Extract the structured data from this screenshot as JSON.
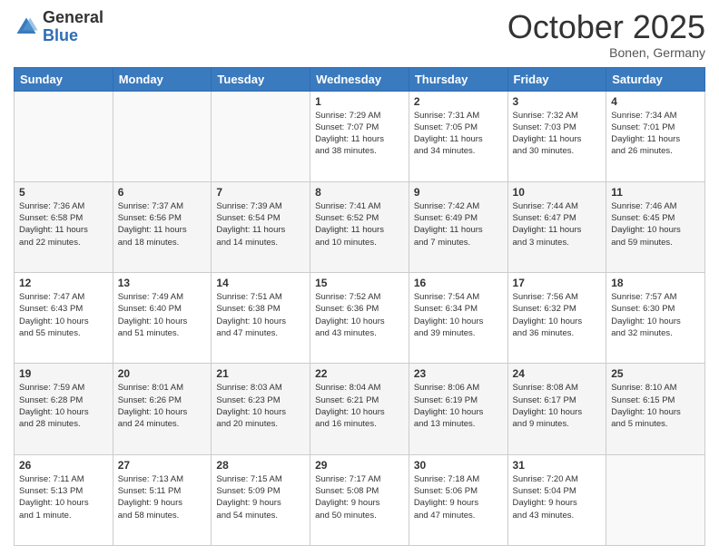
{
  "header": {
    "logo_general": "General",
    "logo_blue": "Blue",
    "month": "October 2025",
    "location": "Bonen, Germany"
  },
  "weekdays": [
    "Sunday",
    "Monday",
    "Tuesday",
    "Wednesday",
    "Thursday",
    "Friday",
    "Saturday"
  ],
  "weeks": [
    [
      {
        "day": "",
        "info": ""
      },
      {
        "day": "",
        "info": ""
      },
      {
        "day": "",
        "info": ""
      },
      {
        "day": "1",
        "info": "Sunrise: 7:29 AM\nSunset: 7:07 PM\nDaylight: 11 hours\nand 38 minutes."
      },
      {
        "day": "2",
        "info": "Sunrise: 7:31 AM\nSunset: 7:05 PM\nDaylight: 11 hours\nand 34 minutes."
      },
      {
        "day": "3",
        "info": "Sunrise: 7:32 AM\nSunset: 7:03 PM\nDaylight: 11 hours\nand 30 minutes."
      },
      {
        "day": "4",
        "info": "Sunrise: 7:34 AM\nSunset: 7:01 PM\nDaylight: 11 hours\nand 26 minutes."
      }
    ],
    [
      {
        "day": "5",
        "info": "Sunrise: 7:36 AM\nSunset: 6:58 PM\nDaylight: 11 hours\nand 22 minutes."
      },
      {
        "day": "6",
        "info": "Sunrise: 7:37 AM\nSunset: 6:56 PM\nDaylight: 11 hours\nand 18 minutes."
      },
      {
        "day": "7",
        "info": "Sunrise: 7:39 AM\nSunset: 6:54 PM\nDaylight: 11 hours\nand 14 minutes."
      },
      {
        "day": "8",
        "info": "Sunrise: 7:41 AM\nSunset: 6:52 PM\nDaylight: 11 hours\nand 10 minutes."
      },
      {
        "day": "9",
        "info": "Sunrise: 7:42 AM\nSunset: 6:49 PM\nDaylight: 11 hours\nand 7 minutes."
      },
      {
        "day": "10",
        "info": "Sunrise: 7:44 AM\nSunset: 6:47 PM\nDaylight: 11 hours\nand 3 minutes."
      },
      {
        "day": "11",
        "info": "Sunrise: 7:46 AM\nSunset: 6:45 PM\nDaylight: 10 hours\nand 59 minutes."
      }
    ],
    [
      {
        "day": "12",
        "info": "Sunrise: 7:47 AM\nSunset: 6:43 PM\nDaylight: 10 hours\nand 55 minutes."
      },
      {
        "day": "13",
        "info": "Sunrise: 7:49 AM\nSunset: 6:40 PM\nDaylight: 10 hours\nand 51 minutes."
      },
      {
        "day": "14",
        "info": "Sunrise: 7:51 AM\nSunset: 6:38 PM\nDaylight: 10 hours\nand 47 minutes."
      },
      {
        "day": "15",
        "info": "Sunrise: 7:52 AM\nSunset: 6:36 PM\nDaylight: 10 hours\nand 43 minutes."
      },
      {
        "day": "16",
        "info": "Sunrise: 7:54 AM\nSunset: 6:34 PM\nDaylight: 10 hours\nand 39 minutes."
      },
      {
        "day": "17",
        "info": "Sunrise: 7:56 AM\nSunset: 6:32 PM\nDaylight: 10 hours\nand 36 minutes."
      },
      {
        "day": "18",
        "info": "Sunrise: 7:57 AM\nSunset: 6:30 PM\nDaylight: 10 hours\nand 32 minutes."
      }
    ],
    [
      {
        "day": "19",
        "info": "Sunrise: 7:59 AM\nSunset: 6:28 PM\nDaylight: 10 hours\nand 28 minutes."
      },
      {
        "day": "20",
        "info": "Sunrise: 8:01 AM\nSunset: 6:26 PM\nDaylight: 10 hours\nand 24 minutes."
      },
      {
        "day": "21",
        "info": "Sunrise: 8:03 AM\nSunset: 6:23 PM\nDaylight: 10 hours\nand 20 minutes."
      },
      {
        "day": "22",
        "info": "Sunrise: 8:04 AM\nSunset: 6:21 PM\nDaylight: 10 hours\nand 16 minutes."
      },
      {
        "day": "23",
        "info": "Sunrise: 8:06 AM\nSunset: 6:19 PM\nDaylight: 10 hours\nand 13 minutes."
      },
      {
        "day": "24",
        "info": "Sunrise: 8:08 AM\nSunset: 6:17 PM\nDaylight: 10 hours\nand 9 minutes."
      },
      {
        "day": "25",
        "info": "Sunrise: 8:10 AM\nSunset: 6:15 PM\nDaylight: 10 hours\nand 5 minutes."
      }
    ],
    [
      {
        "day": "26",
        "info": "Sunrise: 7:11 AM\nSunset: 5:13 PM\nDaylight: 10 hours\nand 1 minute."
      },
      {
        "day": "27",
        "info": "Sunrise: 7:13 AM\nSunset: 5:11 PM\nDaylight: 9 hours\nand 58 minutes."
      },
      {
        "day": "28",
        "info": "Sunrise: 7:15 AM\nSunset: 5:09 PM\nDaylight: 9 hours\nand 54 minutes."
      },
      {
        "day": "29",
        "info": "Sunrise: 7:17 AM\nSunset: 5:08 PM\nDaylight: 9 hours\nand 50 minutes."
      },
      {
        "day": "30",
        "info": "Sunrise: 7:18 AM\nSunset: 5:06 PM\nDaylight: 9 hours\nand 47 minutes."
      },
      {
        "day": "31",
        "info": "Sunrise: 7:20 AM\nSunset: 5:04 PM\nDaylight: 9 hours\nand 43 minutes."
      },
      {
        "day": "",
        "info": ""
      }
    ]
  ]
}
